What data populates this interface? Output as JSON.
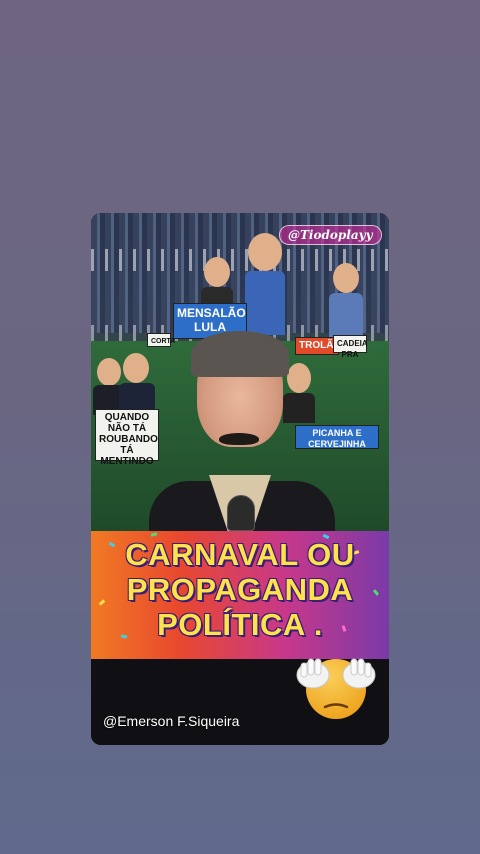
{
  "video": {
    "top_watermark": "@Tiodoplayy",
    "title_lines": [
      "CARNAVAL OU",
      "PROPAGANDA",
      "POLÍTICA ."
    ],
    "credit": "@Emerson F.Siqueira",
    "emoji_icon": "face-palm-hands-over-eyes-emoji"
  },
  "signs": {
    "mensalao": "MENSALÃO LULA",
    "trolao": "TROLÃO",
    "cadeia": "CADEIA PRA",
    "quando": "QUANDO NÃO TÁ ROUBANDO TÁ MENTINDO",
    "picanha": "PICANHA E CERVEJINHA",
    "corta": "CORTA"
  },
  "colors": {
    "banner_gradient": [
      "#f07a24",
      "#e8482e",
      "#c8388a",
      "#7a3aa8"
    ],
    "title_text": "#ffe14a",
    "title_outline": "#3a1f7a"
  }
}
